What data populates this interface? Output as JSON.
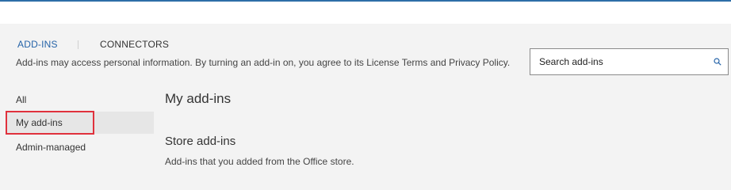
{
  "tabs": [
    {
      "label": "ADD-INS",
      "active": true
    },
    {
      "label": "CONNECTORS",
      "active": false
    }
  ],
  "notice": "Add-ins may access personal information. By turning an add-in on, you agree to its License Terms and Privacy Policy.",
  "search": {
    "placeholder": "Search add-ins",
    "icon": "search-icon"
  },
  "sidebar": {
    "items": [
      {
        "label": "All",
        "selected": false
      },
      {
        "label": "My add-ins",
        "selected": true
      },
      {
        "label": "Admin-managed",
        "selected": false
      }
    ]
  },
  "main": {
    "heading": "My add-ins",
    "store_heading": "Store add-ins",
    "store_description": "Add-ins that you added from the Office store."
  },
  "colors": {
    "accent": "#2563a8",
    "highlight_border": "#e0313c",
    "background": "#f3f3f3",
    "selected_bg": "#e6e6e6"
  }
}
